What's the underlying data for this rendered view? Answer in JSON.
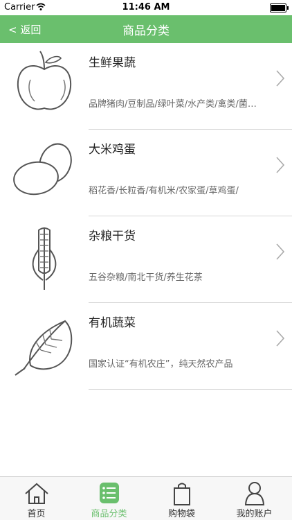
{
  "status_bar": {
    "carrier": "Carrier",
    "time": "11:46 AM"
  },
  "nav": {
    "back_label": "< 返回",
    "title": "商品分类"
  },
  "categories": [
    {
      "name": "生鲜果蔬",
      "desc": "品牌猪肉/豆制品/绿叶菜/水产类/禽类/菌…",
      "icon": "apple-icon"
    },
    {
      "name": "大米鸡蛋",
      "desc": "稻花香/长粒香/有机米/农家蛋/草鸡蛋/",
      "icon": "eggs-icon"
    },
    {
      "name": "杂粮干货",
      "desc": "五谷杂粮/南北干货/养生花茶",
      "icon": "corn-icon"
    },
    {
      "name": "有机蔬菜",
      "desc": "国家认证“有机农庄”，纯天然农产品",
      "icon": "leaf-icon"
    }
  ],
  "tabs": [
    {
      "label": "首页",
      "icon": "home-icon"
    },
    {
      "label": "商品分类",
      "icon": "category-list-icon"
    },
    {
      "label": "购物袋",
      "icon": "shopping-bag-icon"
    },
    {
      "label": "我的账户",
      "icon": "account-icon"
    }
  ],
  "colors": {
    "accent": "#6abf6d",
    "separator": "#d6d6d6"
  }
}
